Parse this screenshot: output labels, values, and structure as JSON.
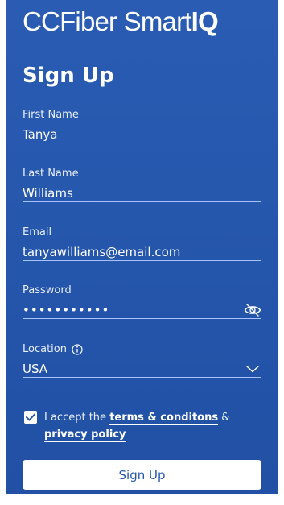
{
  "brand": {
    "name_regular": "CCFiber Smart",
    "name_bold": "IQ"
  },
  "form": {
    "title": "Sign Up",
    "fields": {
      "first_name": {
        "label": "First Name",
        "value": "Tanya"
      },
      "last_name": {
        "label": "Last Name",
        "value": "Williams"
      },
      "email": {
        "label": "Email",
        "value": "tanyawilliams@email.com"
      },
      "password": {
        "label": "Password",
        "value": "•••••••••••",
        "toggle_icon": "eye-off-icon"
      },
      "location": {
        "label": "Location",
        "value": "USA",
        "info_icon": "info-icon",
        "dropdown_icon": "chevron-down-icon"
      }
    },
    "terms": {
      "checked": true,
      "prefix": "I accept the ",
      "terms_link": "terms & conditons",
      "joiner": " & ",
      "privacy_link": "privacy policy"
    },
    "submit_label": "Sign Up"
  },
  "colors": {
    "background": "#2557ad",
    "underline": "#a9c3ff",
    "button_bg": "#ffffff",
    "button_text": "#2557ad"
  }
}
